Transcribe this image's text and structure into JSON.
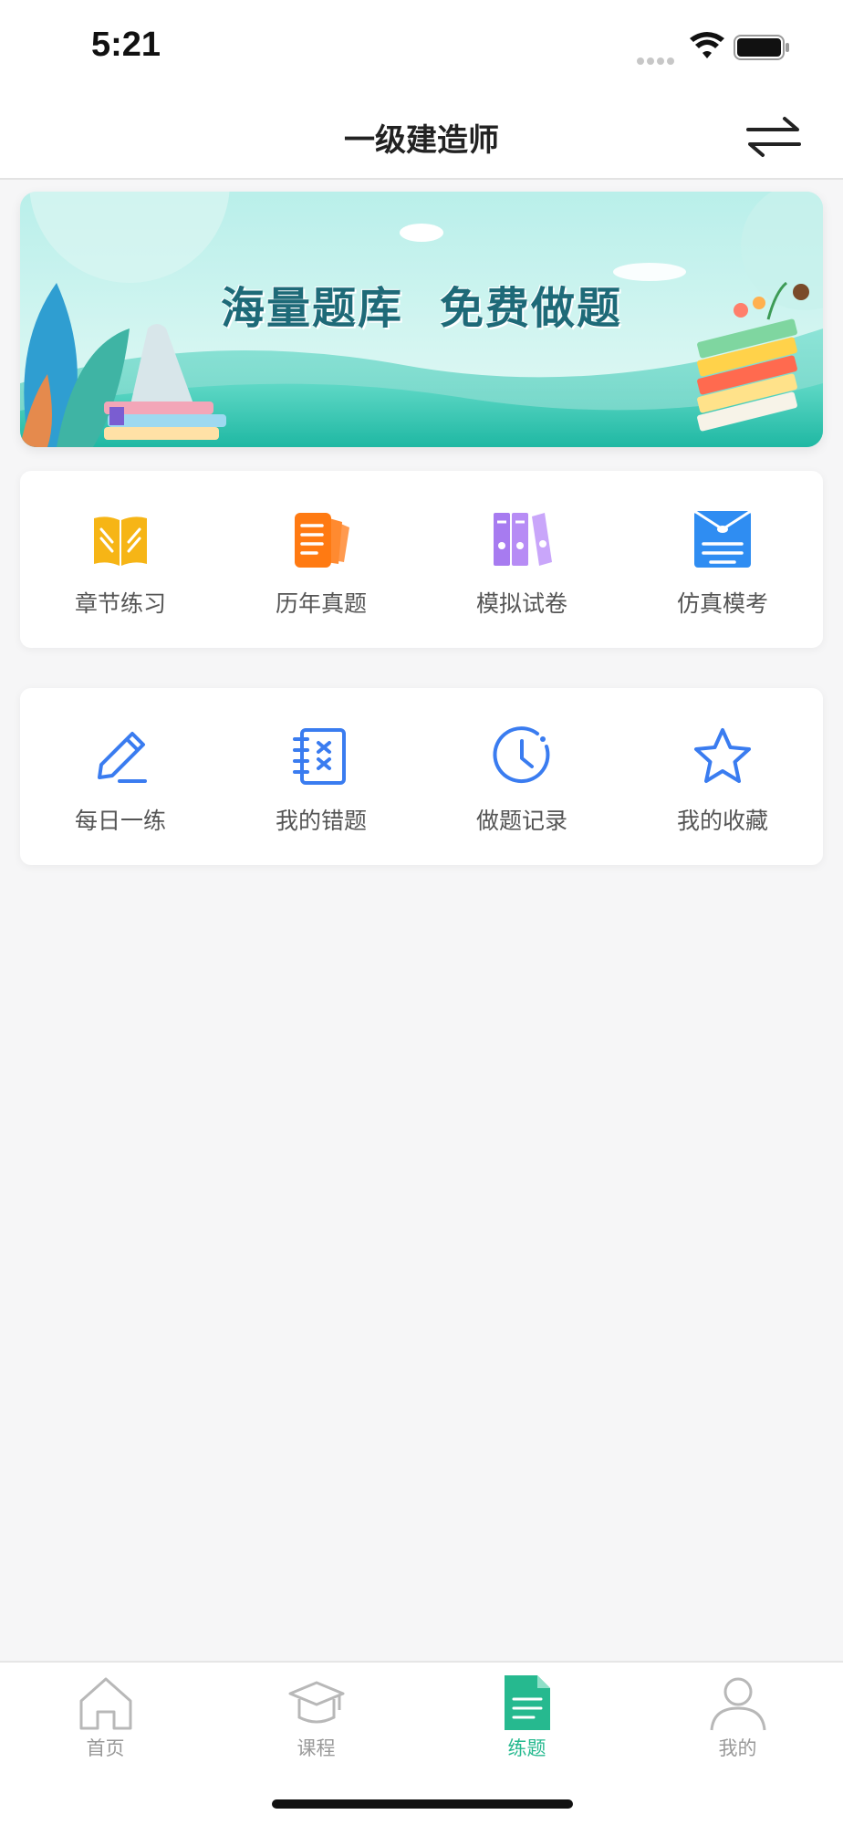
{
  "status": {
    "time": "5:21"
  },
  "header": {
    "title": "一级建造师",
    "switch_icon": "swap-arrows-icon"
  },
  "banner": {
    "headline_left": "海量题库",
    "headline_right": "免费做题"
  },
  "practice_modes": [
    {
      "label": "章节练习",
      "icon": "open-book-icon",
      "color": "#f6b516"
    },
    {
      "label": "历年真题",
      "icon": "document-stack-icon",
      "color": "#ff7a12"
    },
    {
      "label": "模拟试卷",
      "icon": "binders-icon",
      "color": "#b78cf5"
    },
    {
      "label": "仿真模考",
      "icon": "envelope-exam-icon",
      "color": "#2f8df2"
    }
  ],
  "tools": [
    {
      "label": "每日一练",
      "icon": "pencil-icon",
      "color": "#3a7cf0"
    },
    {
      "label": "我的错题",
      "icon": "notebook-x-icon",
      "color": "#3a7cf0"
    },
    {
      "label": "做题记录",
      "icon": "clock-icon",
      "color": "#3a7cf0"
    },
    {
      "label": "我的收藏",
      "icon": "star-icon",
      "color": "#3a7cf0"
    }
  ],
  "tabbar": {
    "items": [
      {
        "label": "首页",
        "icon": "home-icon",
        "active": false
      },
      {
        "label": "课程",
        "icon": "graduation-cap-icon",
        "active": false
      },
      {
        "label": "练题",
        "icon": "document-icon",
        "active": true
      },
      {
        "label": "我的",
        "icon": "user-icon",
        "active": false
      }
    ],
    "active_color": "#26b98f",
    "inactive_color": "#9a9a9a"
  }
}
